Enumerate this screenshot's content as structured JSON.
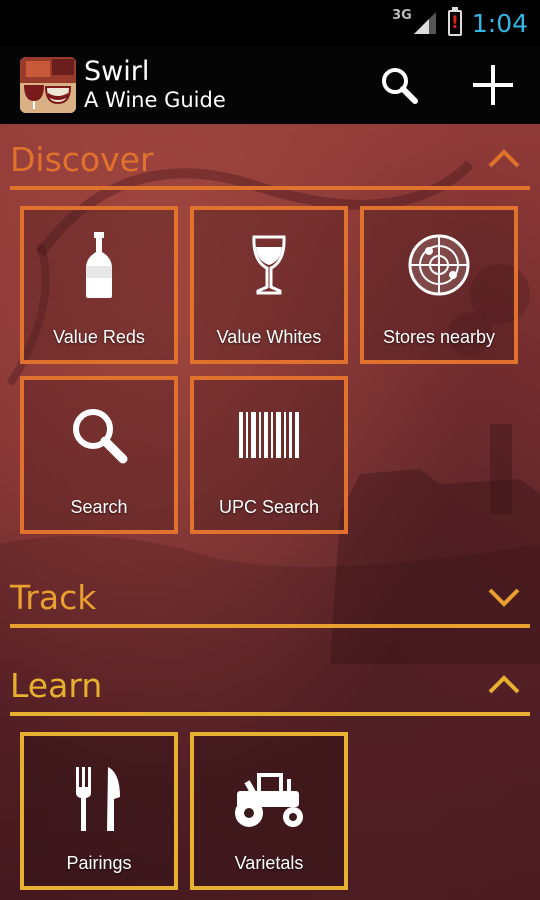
{
  "status_bar": {
    "network": "3G",
    "time": "1:04",
    "clock_color": "#33b5e5"
  },
  "action_bar": {
    "title": "Swirl",
    "subtitle": "A Wine Guide",
    "actions": [
      {
        "icon": "search-icon"
      },
      {
        "icon": "plus-icon"
      }
    ]
  },
  "sections": {
    "discover": {
      "title": "Discover",
      "color": "#e0722d",
      "expanded": true,
      "tiles": [
        {
          "label": "Value Reds",
          "icon": "wine-bottle-icon"
        },
        {
          "label": "Value Whites",
          "icon": "wine-glass-icon"
        },
        {
          "label": "Stores nearby",
          "icon": "radar-icon"
        },
        {
          "label": "Search",
          "icon": "search-icon"
        },
        {
          "label": "UPC Search",
          "icon": "barcode-icon"
        }
      ]
    },
    "track": {
      "title": "Track",
      "color": "#e8a030",
      "expanded": false
    },
    "learn": {
      "title": "Learn",
      "color": "#e8b030",
      "expanded": true,
      "tiles": [
        {
          "label": "Pairings",
          "icon": "fork-knife-icon"
        },
        {
          "label": "Varietals",
          "icon": "tractor-icon"
        }
      ]
    }
  }
}
